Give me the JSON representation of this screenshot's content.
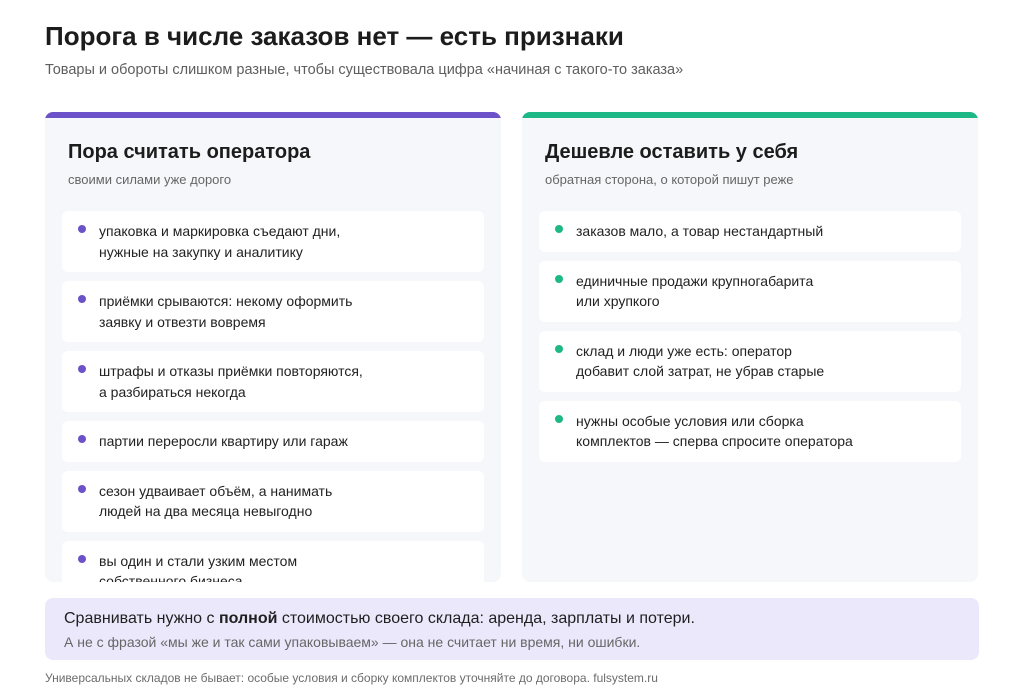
{
  "header": {
    "title": "Порога в числе заказов нет — есть признаки",
    "subtitle": "Товары и обороты слишком разные, чтобы существовала цифра «начиная с такого-то заказа»"
  },
  "cards": [
    {
      "accent": "#6b52c9",
      "title": "Пора считать оператора",
      "subtitle": "своими силами уже дорого",
      "items": [
        "упаковка и маркировка съедают дни,\nнужные на закупку и аналитику",
        "приёмки срываются: некому оформить\nзаявку и отвезти вовремя",
        "штрафы и отказы приёмки повторяются,\nа разбираться некогда",
        "партии переросли квартиру или гараж",
        "сезон удваивает объём, а нанимать\nлюдей на два месяца невыгодно",
        "вы один и стали узким местом\nсобственного бизнеса"
      ]
    },
    {
      "accent": "#1db886",
      "title": "Дешевле оставить у себя",
      "subtitle": "обратная сторона, о которой пишут реже",
      "items": [
        "заказов мало, а товар нестандартный",
        "единичные продажи крупногабарита\nили хрупкого",
        "склад и люди уже есть: оператор\nдобавит слой затрат, не убрав старые",
        "нужны особые условия или сборка\nкомплектов — сперва спросите оператора"
      ]
    }
  ],
  "note": {
    "main_before": "Сравнивать нужно с ",
    "main_bold": "полной",
    "main_after": " стоимостью своего склада: аренда, зарплаты и потери.",
    "sub": "А не с фразой «мы же и так сами упаковываем» — она не считает ни время, ни ошибки.",
    "background": "#ece8fb"
  },
  "footer": "Универсальных складов не бывает: особые условия и сборку комплектов уточняйте до договора. fulsystem.ru"
}
